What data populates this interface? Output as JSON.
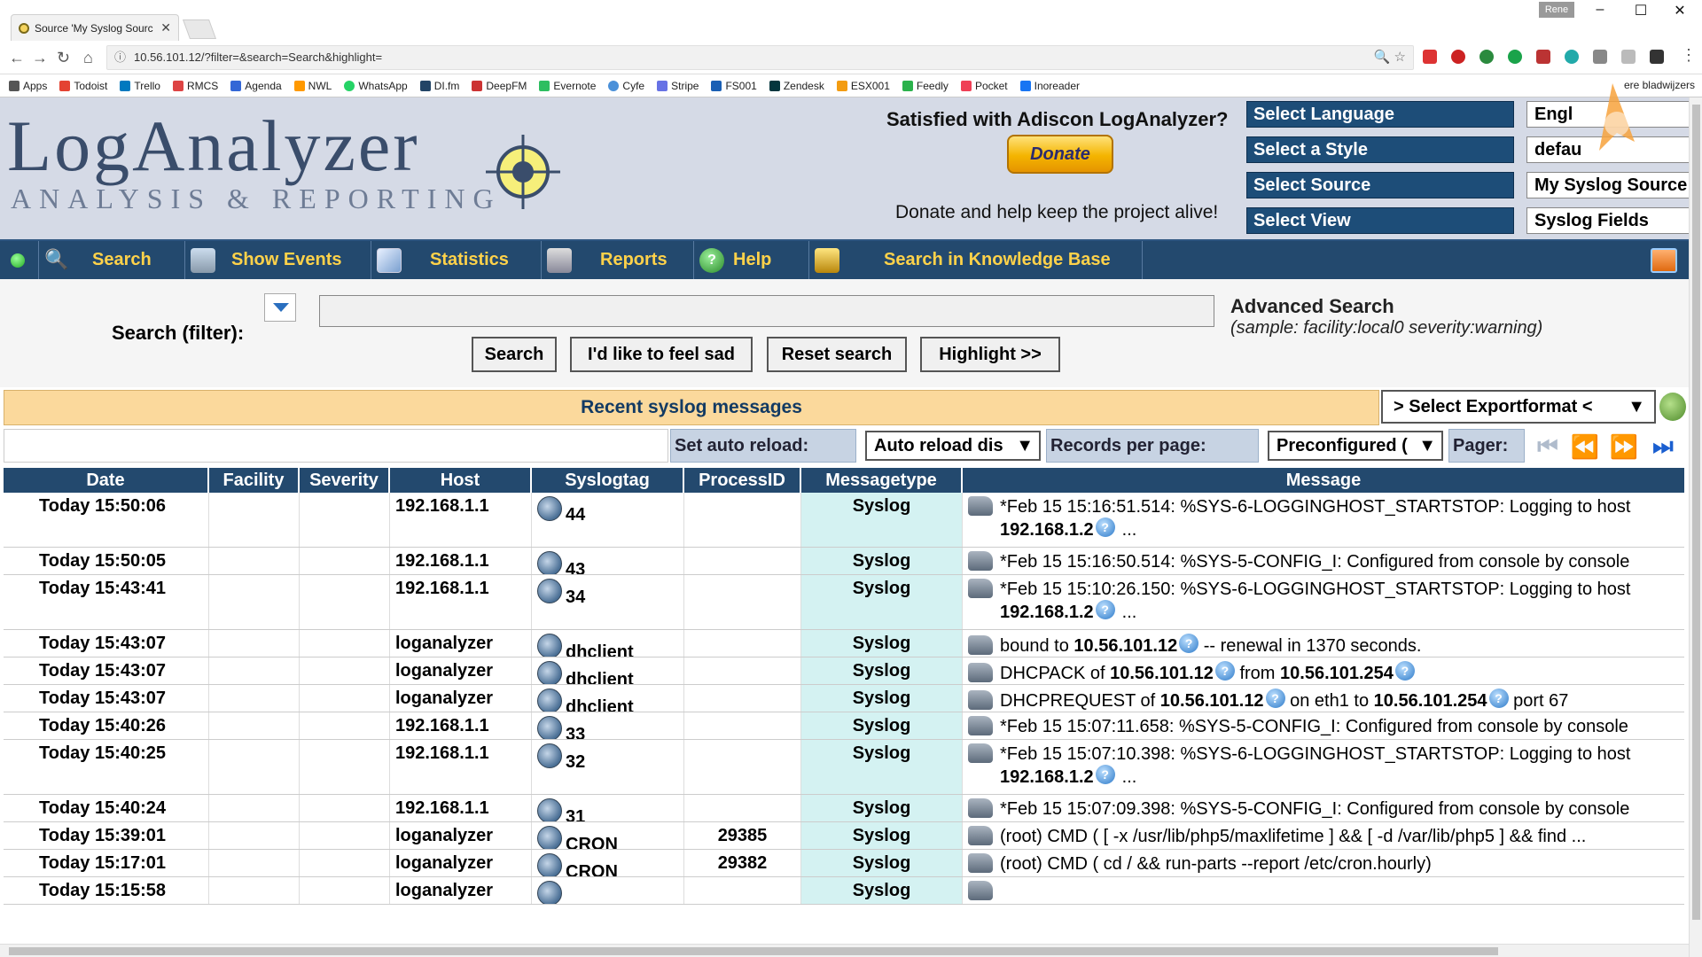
{
  "browser": {
    "tab_title": "Source 'My Syslog Sourc",
    "user": "Rene",
    "url": "10.56.101.12/?filter=&search=Search&highlight=",
    "bookmarks": [
      "Apps",
      "Todoist",
      "Trello",
      "RMCS",
      "Agenda",
      "NWL",
      "WhatsApp",
      "DI.fm",
      "DeepFM",
      "Evernote",
      "Cyfe",
      "Stripe",
      "FS001",
      "Zendesk",
      "ESX001",
      "Feedly",
      "Pocket",
      "Inoreader"
    ],
    "other_bookmarks": "ere bladwijzers"
  },
  "header": {
    "logo_title": "LogAnalyzer",
    "logo_subtitle": "ANALYSIS & REPORTING",
    "satisfied": "Satisfied with Adiscon LogAnalyzer?",
    "donate": "Donate",
    "donate_help": "Donate and help keep the project alive!",
    "selectors": [
      {
        "label": "Select Language",
        "value": "Engl"
      },
      {
        "label": "Select a Style",
        "value": "defau"
      },
      {
        "label": "Select Source",
        "value": "My Syslog Source"
      },
      {
        "label": "Select View",
        "value": "Syslog Fields"
      }
    ]
  },
  "menu": {
    "search": "Search",
    "show_events": "Show Events",
    "statistics": "Statistics",
    "reports": "Reports",
    "help": "Help",
    "knowledge_base": "Search in Knowledge Base"
  },
  "search": {
    "label": "Search (filter):",
    "value": "",
    "buttons": {
      "search": "Search",
      "feel_sad": "I'd like to feel sad",
      "reset": "Reset search",
      "highlight": "Highlight >>"
    },
    "advanced_title": "Advanced Search",
    "advanced_sample": "(sample: facility:local0 severity:warning)"
  },
  "recent": {
    "title": "Recent syslog messages",
    "export_format": "> Select Exportformat <"
  },
  "controls": {
    "auto_reload_label": "Set auto reload:",
    "auto_reload_value": "Auto reload dis",
    "records_label": "Records per page:",
    "records_value": "Preconfigured (",
    "pager_label": "Pager:"
  },
  "table": {
    "headers": [
      "Date",
      "Facility",
      "Severity",
      "Host",
      "Syslogtag",
      "ProcessID",
      "Messagetype",
      "Message"
    ],
    "rows": [
      {
        "date": "Today 15:50:06",
        "facility": "",
        "severity": "",
        "host": "192.168.1.1",
        "tag": "44",
        "pid": "",
        "type": "Syslog",
        "msg": "*Feb 15 15:16:51.514: %SYS-6-LOGGINGHOST_STARTSTOP: Logging to host",
        "msg2": "192.168.1.2",
        "msg2_tail": "..."
      },
      {
        "date": "Today 15:50:05",
        "facility": "",
        "severity": "",
        "host": "192.168.1.1",
        "tag": "43",
        "pid": "",
        "type": "Syslog",
        "msg": "*Feb 15 15:16:50.514: %SYS-5-CONFIG_I: Configured from console by console"
      },
      {
        "date": "Today 15:43:41",
        "facility": "",
        "severity": "",
        "host": "192.168.1.1",
        "tag": "34",
        "pid": "",
        "type": "Syslog",
        "msg": "*Feb 15 15:10:26.150: %SYS-6-LOGGINGHOST_STARTSTOP: Logging to host",
        "msg2": "192.168.1.2",
        "msg2_tail": "..."
      },
      {
        "date": "Today 15:43:07",
        "facility": "",
        "severity": "",
        "host": "loganalyzer",
        "tag": "dhclient",
        "pid": "",
        "type": "Syslog",
        "parts": [
          {
            "t": "bound to "
          },
          {
            "b": "10.56.101.12",
            "q": true
          },
          {
            "t": " -- renewal in 1370 seconds."
          }
        ]
      },
      {
        "date": "Today 15:43:07",
        "facility": "",
        "severity": "",
        "host": "loganalyzer",
        "tag": "dhclient",
        "pid": "",
        "type": "Syslog",
        "parts": [
          {
            "t": "DHCPACK of "
          },
          {
            "b": "10.56.101.12",
            "q": true
          },
          {
            "t": " from "
          },
          {
            "b": "10.56.101.254",
            "q": true
          }
        ]
      },
      {
        "date": "Today 15:43:07",
        "facility": "",
        "severity": "",
        "host": "loganalyzer",
        "tag": "dhclient",
        "pid": "",
        "type": "Syslog",
        "parts": [
          {
            "t": "DHCPREQUEST of "
          },
          {
            "b": "10.56.101.12",
            "q": true
          },
          {
            "t": " on eth1 to "
          },
          {
            "b": "10.56.101.254",
            "q": true
          },
          {
            "t": " port 67"
          }
        ]
      },
      {
        "date": "Today 15:40:26",
        "facility": "",
        "severity": "",
        "host": "192.168.1.1",
        "tag": "33",
        "pid": "",
        "type": "Syslog",
        "msg": "*Feb 15 15:07:11.658: %SYS-5-CONFIG_I: Configured from console by console"
      },
      {
        "date": "Today 15:40:25",
        "facility": "",
        "severity": "",
        "host": "192.168.1.1",
        "tag": "32",
        "pid": "",
        "type": "Syslog",
        "msg": "*Feb 15 15:07:10.398: %SYS-6-LOGGINGHOST_STARTSTOP: Logging to host",
        "msg2": "192.168.1.2",
        "msg2_tail": "..."
      },
      {
        "date": "Today 15:40:24",
        "facility": "",
        "severity": "",
        "host": "192.168.1.1",
        "tag": "31",
        "pid": "",
        "type": "Syslog",
        "msg": "*Feb 15 15:07:09.398: %SYS-5-CONFIG_I: Configured from console by console"
      },
      {
        "date": "Today 15:39:01",
        "facility": "",
        "severity": "",
        "host": "loganalyzer",
        "tag": "CRON",
        "pid": "29385",
        "type": "Syslog",
        "msg": "(root) CMD ( [ -x /usr/lib/php5/maxlifetime ] && [ -d /var/lib/php5 ] && find ..."
      },
      {
        "date": "Today 15:17:01",
        "facility": "",
        "severity": "",
        "host": "loganalyzer",
        "tag": "CRON",
        "pid": "29382",
        "type": "Syslog",
        "msg": "(root) CMD ( cd / && run-parts --report /etc/cron.hourly)"
      },
      {
        "date": "Today 15:15:58",
        "facility": "",
        "severity": "",
        "host": "loganalyzer",
        "tag": "",
        "pid": "",
        "type": "Syslog",
        "msg": ""
      }
    ]
  }
}
